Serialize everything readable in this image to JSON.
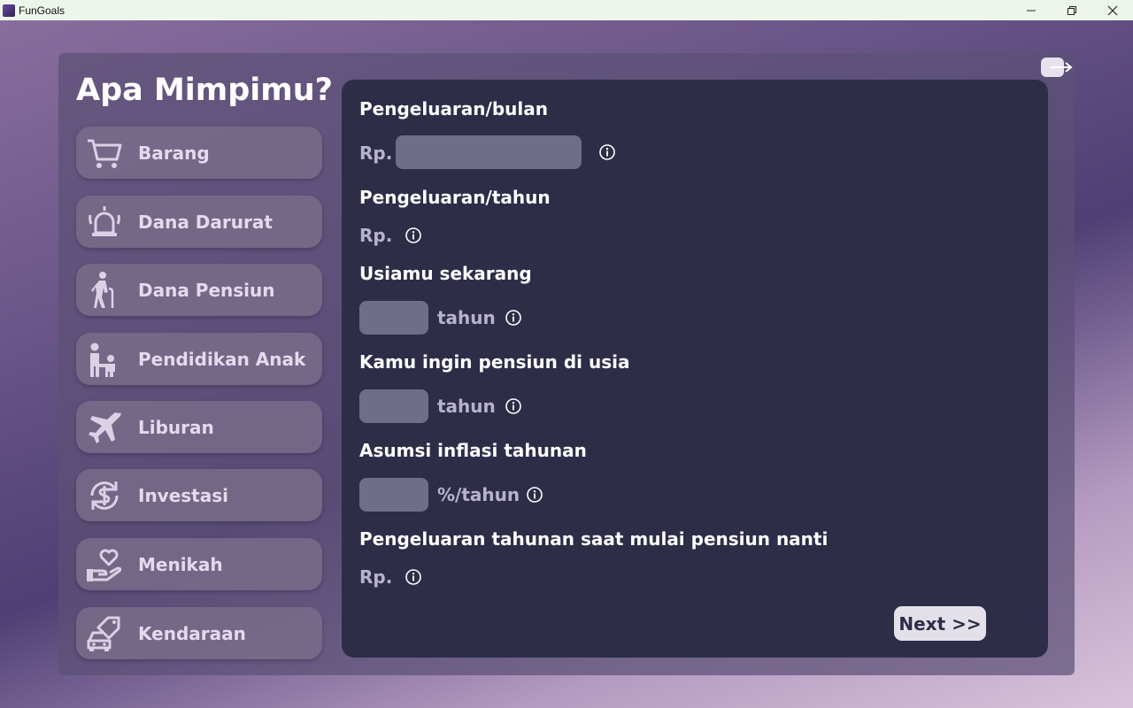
{
  "window": {
    "title": "FunGoals"
  },
  "heading": "Apa Mimpimu?",
  "sidebar": {
    "items": [
      {
        "label": "Barang",
        "icon": "cart-icon"
      },
      {
        "label": "Dana Darurat",
        "icon": "alarm-bell-icon"
      },
      {
        "label": "Dana Pensiun",
        "icon": "elderly-person-icon"
      },
      {
        "label": "Pendidikan Anak",
        "icon": "parent-child-icon"
      },
      {
        "label": "Liburan",
        "icon": "airplane-icon"
      },
      {
        "label": "Investasi",
        "icon": "dollar-exchange-icon"
      },
      {
        "label": "Menikah",
        "icon": "hand-heart-icon"
      },
      {
        "label": "Kendaraan",
        "icon": "car-tag-icon"
      }
    ]
  },
  "form": {
    "monthly_expense": {
      "label": "Pengeluaran/bulan",
      "prefix": "Rp.",
      "value": ""
    },
    "yearly_expense": {
      "label": "Pengeluaran/tahun",
      "prefix": "Rp.",
      "value": ""
    },
    "current_age": {
      "label": "Usiamu sekarang",
      "unit": "tahun",
      "value": ""
    },
    "retire_age": {
      "label": "Kamu ingin pensiun di usia",
      "unit": "tahun",
      "value": ""
    },
    "inflation": {
      "label": "Asumsi inflasi tahunan",
      "unit": "%/tahun",
      "value": ""
    },
    "retire_expense": {
      "label": "Pengeluaran tahunan saat mulai pensiun nanti",
      "prefix": "Rp.",
      "value": ""
    }
  },
  "next_label": "Next >>",
  "colors": {
    "form_bg": "#2d2d48",
    "input_bg": "#6e6e8a",
    "sidebar_item_bg": "#786c8a",
    "label_muted": "#b9b2cc"
  }
}
